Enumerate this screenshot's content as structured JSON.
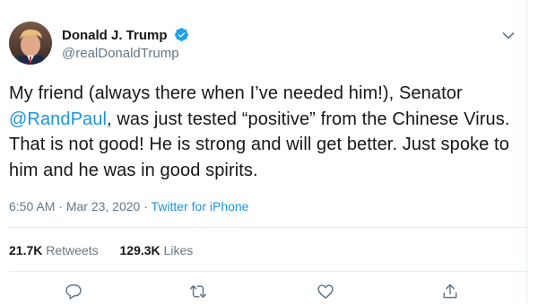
{
  "author": {
    "display_name": "Donald J. Trump",
    "handle": "@realDonaldTrump",
    "verified": true
  },
  "tweet": {
    "text_before": "My friend (always there when I’ve needed him!), Senator ",
    "mention": "@RandPaul",
    "text_after": ", was just tested “positive” from the Chinese Virus. That is not good! He is strong and will get better. Just spoke to him and he was in good spirits."
  },
  "meta": {
    "time": "6:50 AM",
    "separator": " · ",
    "date": "Mar 23, 2020",
    "separator2": " · ",
    "source": "Twitter for iPhone"
  },
  "stats": {
    "retweets_count": "21.7K",
    "retweets_label": "Retweets",
    "likes_count": "129.3K",
    "likes_label": "Likes"
  },
  "actions": {
    "reply_icon": "reply-icon",
    "retweet_icon": "retweet-icon",
    "like_icon": "heart-icon",
    "share_icon": "share-icon"
  },
  "colors": {
    "link": "#1b95e0",
    "secondary_text": "#657786",
    "verified_badge": "#1da1f2",
    "primary_text": "#14171a"
  }
}
